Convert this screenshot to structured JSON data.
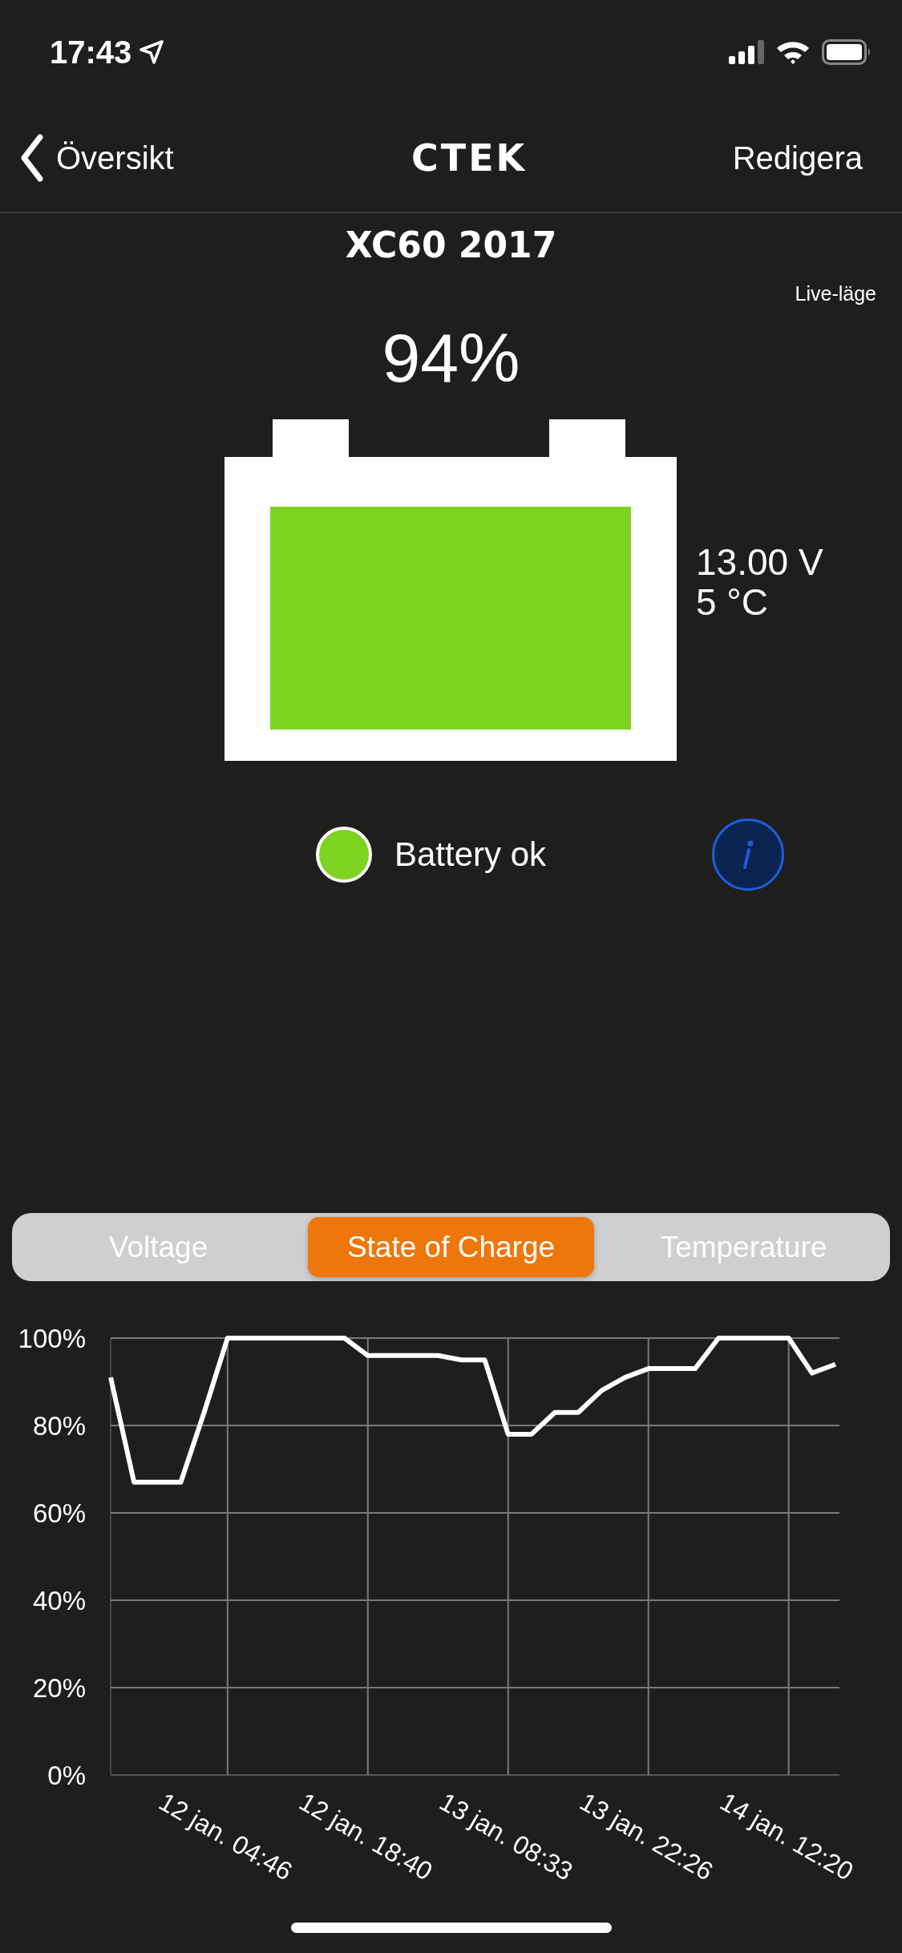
{
  "status_bar": {
    "time": "17:43"
  },
  "nav": {
    "back": "Översikt",
    "logo": "CTEK",
    "action": "Redigera"
  },
  "vehicle": {
    "title": "XC60 2017",
    "mode": "Live-läge",
    "percent": "94%",
    "voltage": "13.00 V",
    "temperature": "5 °C"
  },
  "battery_state": {
    "label": "Battery ok",
    "color": "#7ed321"
  },
  "tabs": [
    {
      "label": "Voltage",
      "selected": false
    },
    {
      "label": "State of Charge",
      "selected": true
    },
    {
      "label": "Temperature",
      "selected": false
    }
  ],
  "chart": {
    "chart_data": {
      "type": "line",
      "categories": [
        null,
        null,
        null,
        null,
        null,
        "12 jan. 04:46",
        null,
        null,
        null,
        null,
        null,
        "12 jan. 18:40",
        null,
        null,
        null,
        null,
        null,
        "13 jan. 08:33",
        null,
        null,
        null,
        null,
        null,
        "13 jan. 22:26",
        null,
        null,
        null,
        null,
        null,
        "14 jan. 12:20",
        null,
        null
      ],
      "series": [
        {
          "color": "#ffffff",
          "values": [
            91,
            67,
            67,
            67,
            83,
            100,
            100,
            100,
            100,
            100,
            100,
            96,
            96,
            96,
            96,
            95,
            95,
            78,
            78,
            83,
            83,
            88,
            91,
            93,
            93,
            93,
            100,
            100,
            100,
            100,
            92,
            94
          ]
        }
      ],
      "ylim": [
        0,
        100
      ],
      "grid": true,
      "yticks": [
        {
          "value": 0,
          "label": "0%"
        },
        {
          "value": 20,
          "label": "20%"
        },
        {
          "value": 40,
          "label": "40%"
        },
        {
          "value": 60,
          "label": "60%"
        },
        {
          "value": 80,
          "label": "80%"
        },
        {
          "value": 100,
          "label": "100%"
        }
      ]
    }
  }
}
